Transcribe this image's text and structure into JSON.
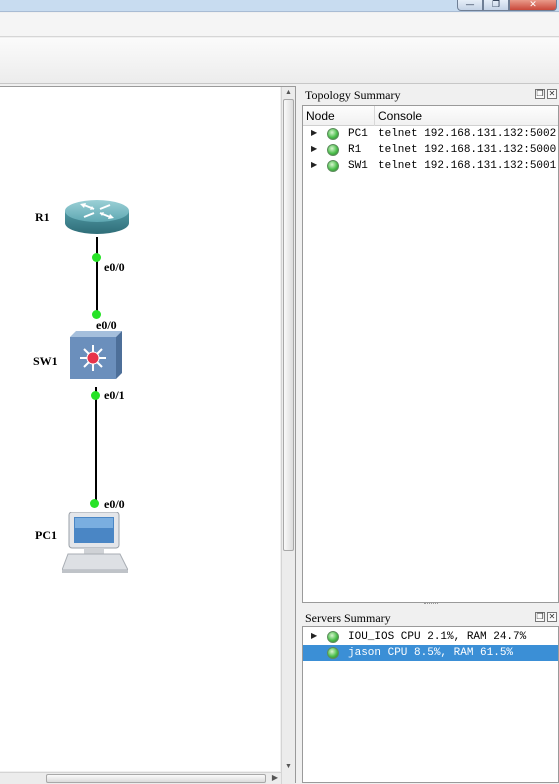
{
  "window": {
    "buttons": [
      {
        "name": "minimize",
        "glyph": "—"
      },
      {
        "name": "maximize",
        "glyph": "❐"
      },
      {
        "name": "close",
        "glyph": "✕"
      }
    ]
  },
  "topology": {
    "nodes": [
      {
        "name": "R1",
        "type": "router"
      },
      {
        "name": "SW1",
        "type": "switch"
      },
      {
        "name": "PC1",
        "type": "pc"
      }
    ],
    "ports": {
      "r1_e00": "e0/0",
      "sw1_e00": "e0/0",
      "sw1_e01": "e0/1",
      "pc1_e00": "e0/0"
    },
    "link_color": "#000000",
    "port_color": "#27e327"
  },
  "topology_summary": {
    "title": "Topology Summary",
    "columns": [
      "Node",
      "Console"
    ],
    "rows": [
      {
        "node": "PC1",
        "console": "telnet 192.168.131.132:5002",
        "status": "started"
      },
      {
        "node": "R1",
        "console": "telnet 192.168.131.132:5000",
        "status": "started"
      },
      {
        "node": "SW1",
        "console": "telnet 192.168.131.132:5001",
        "status": "started"
      }
    ]
  },
  "servers_summary": {
    "title": "Servers Summary",
    "rows": [
      {
        "text": "IOU_IOS CPU 2.1%, RAM 24.7%",
        "selected": false,
        "expandable": true
      },
      {
        "text": "jason CPU 8.5%, RAM 61.5%",
        "selected": true,
        "expandable": false
      }
    ],
    "selection_color": "#3b8fd6"
  },
  "icons": {
    "float": "float-dock-icon",
    "close": "close-dock-icon",
    "expander": "expand-arrow-icon",
    "status": "status-led-icon"
  }
}
